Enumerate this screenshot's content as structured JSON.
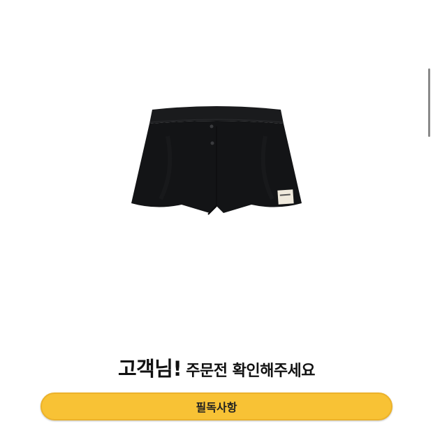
{
  "product": {
    "image_icon": "black-shorts-image",
    "tag_text": "SLOWAND"
  },
  "notice": {
    "heading_lead": "고객님!",
    "heading_rest": "주문전 확인해주세요"
  },
  "button": {
    "label": "필독사항",
    "color": "#f8c235"
  }
}
